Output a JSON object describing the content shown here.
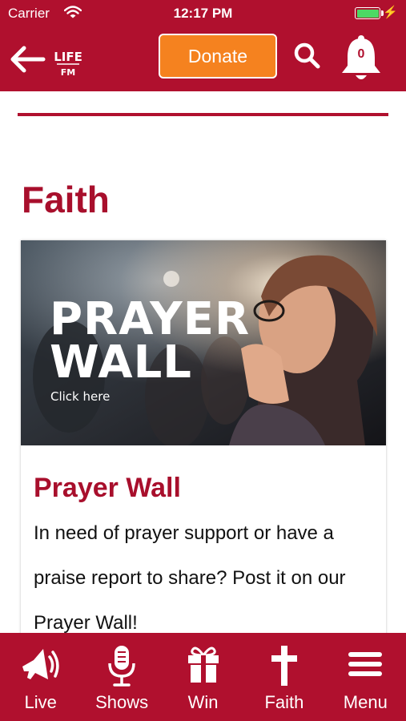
{
  "status_bar": {
    "carrier": "Carrier",
    "time": "12:17 PM"
  },
  "header": {
    "back_icon": "arrow-left-icon",
    "logo_text_top": "LIFE",
    "logo_text_bottom": "FM",
    "donate_label": "Donate",
    "search_icon": "search-icon",
    "notification_icon": "bell-icon",
    "notification_count": "0"
  },
  "page": {
    "title": "Faith"
  },
  "card": {
    "image_heading_line1": "PRAYER",
    "image_heading_line2": "WALL",
    "image_cta": "Click here",
    "title": "Prayer Wall",
    "body": "In need of prayer support or have a praise report to share? Post it on our Prayer Wall!"
  },
  "tab_bar": {
    "tabs": [
      {
        "label": "Live",
        "icon": "speaker-icon"
      },
      {
        "label": "Shows",
        "icon": "microphone-icon"
      },
      {
        "label": "Win",
        "icon": "gift-icon"
      },
      {
        "label": "Faith",
        "icon": "cross-icon"
      },
      {
        "label": "Menu",
        "icon": "hamburger-menu-icon"
      }
    ]
  },
  "colors": {
    "brand": "#b0102e",
    "accent": "#f5821f",
    "title": "#a80f2c"
  }
}
